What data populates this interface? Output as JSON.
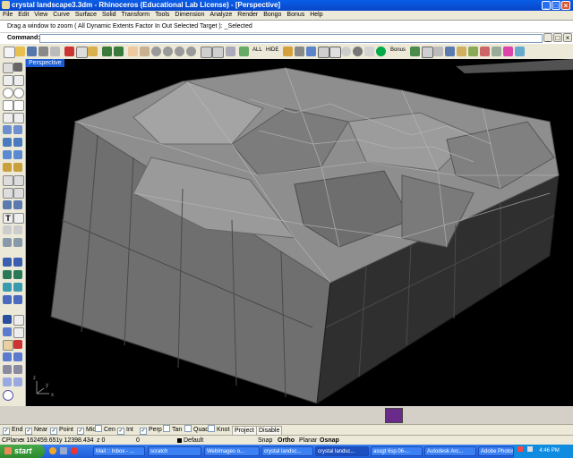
{
  "window": {
    "title": "crystal landscape3.3dm - Rhinoceros (Educational Lab License) - [Perspective]"
  },
  "menu": [
    "File",
    "Edit",
    "View",
    "Curve",
    "Surface",
    "Solid",
    "Transform",
    "Tools",
    "Dimension",
    "Analyze",
    "Render",
    "Bongo",
    "Bonus",
    "Help"
  ],
  "command_history": "Drag a window to zoom ( All  Dynamic  Extents  Factor  In  Out  Selected  Target ): _Selected",
  "command": {
    "label": "Command:",
    "value": ""
  },
  "toolbar": {
    "all_label": "ALL",
    "hide_label": "HIDE",
    "bonus_label": "Bonus"
  },
  "viewport": {
    "tab_label": "Perspective",
    "axis_x": "x",
    "axis_y": "y",
    "axis_z": "z"
  },
  "osnap": {
    "items": [
      {
        "label": "End",
        "checked": true
      },
      {
        "label": "Near",
        "checked": true
      },
      {
        "label": "Point",
        "checked": true
      },
      {
        "label": "Mid",
        "checked": true
      },
      {
        "label": "Cen",
        "checked": false
      },
      {
        "label": "Int",
        "checked": true
      },
      {
        "label": "Perp",
        "checked": true
      },
      {
        "label": "Tan",
        "checked": false
      },
      {
        "label": "Quad",
        "checked": false
      },
      {
        "label": "Knot",
        "checked": false
      }
    ],
    "project_label": "Project",
    "disable_label": "Disable"
  },
  "status": {
    "cplane": "CPlane",
    "x": "x 162459.651",
    "y": "y 12398.434",
    "z": "z 0",
    "extra": "0",
    "layer": "Default",
    "snap": "Snap",
    "ortho": "Ortho",
    "planar": "Planar",
    "osnap": "Osnap"
  },
  "taskbar": {
    "start_label": "start",
    "tasks": [
      "Mail :: Inbox - ...",
      "scratch",
      "WebImages o...",
      "crystal landsc...",
      "crystal landsc...",
      "assgt 6sp.06-...",
      "Autodesk Arc...",
      "Adobe Photos..."
    ],
    "clock": "4:46 PM"
  },
  "colors": {
    "titlebar": "#0846c8",
    "viewport_bg": "#000000",
    "taskbar": "#1f5cd8",
    "start": "#2f8a2f"
  }
}
